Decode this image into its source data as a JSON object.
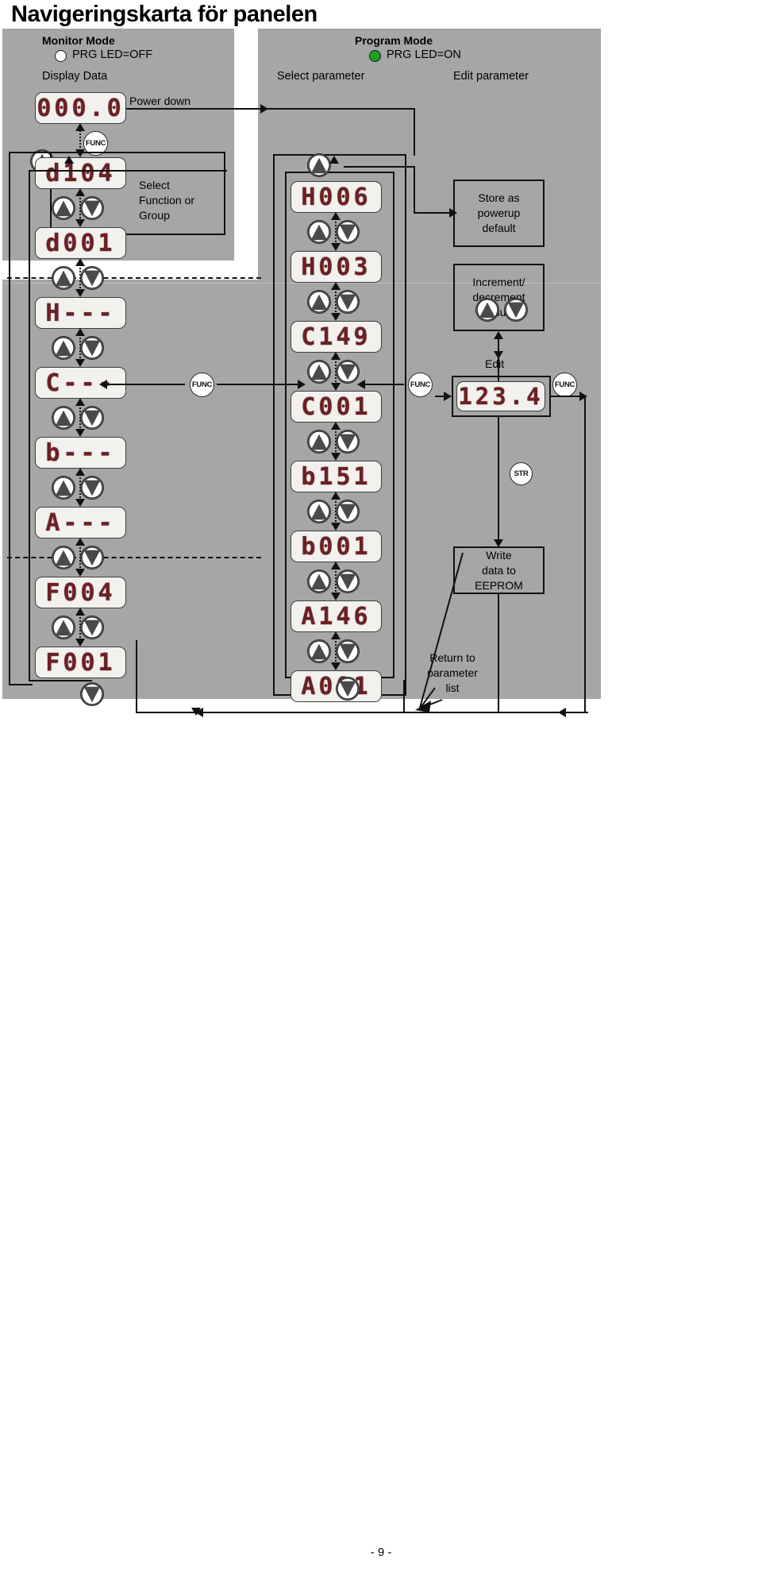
{
  "page": {
    "title": "Navigeringskarta för panelen",
    "footer": "- 9 -"
  },
  "monitor_mode": {
    "heading": "Monitor Mode",
    "led_label": "PRG LED=OFF",
    "led_state": "off",
    "led_color": "#ffffff",
    "column_label": "Display Data",
    "power_down_label": "Power down",
    "select_function_label": "Select\nFunction or\nGroup",
    "select_function_lines": [
      "Select",
      "Function or",
      "Group"
    ],
    "displays": [
      {
        "value": "000.0",
        "name": "display-000-0"
      },
      {
        "value": "d104",
        "name": "display-d104"
      },
      {
        "value": "d001",
        "name": "display-d001"
      },
      {
        "value": "H---",
        "name": "display-h-dashes"
      },
      {
        "value": "C---",
        "name": "display-c-dashes"
      },
      {
        "value": "b---",
        "name": "display-b-dashes"
      },
      {
        "value": "A---",
        "name": "display-a-dashes"
      },
      {
        "value": "F004",
        "name": "display-f004"
      },
      {
        "value": "F001",
        "name": "display-f001"
      }
    ]
  },
  "program_mode": {
    "heading": "Program Mode",
    "led_label": "PRG LED=ON",
    "led_state": "on",
    "led_color": "#1f9f21",
    "select_parameter_label": "Select parameter",
    "edit_parameter_label": "Edit parameter",
    "edit_label": "Edit",
    "displays": [
      {
        "value": "H006",
        "name": "display-h006"
      },
      {
        "value": "H003",
        "name": "display-h003"
      },
      {
        "value": "C149",
        "name": "display-c149"
      },
      {
        "value": "C001",
        "name": "display-c001"
      },
      {
        "value": "b151",
        "name": "display-b151"
      },
      {
        "value": "b001",
        "name": "display-b001"
      },
      {
        "value": "A146",
        "name": "display-a146"
      },
      {
        "value": "A001",
        "name": "display-a001"
      }
    ],
    "edit_display": {
      "value": "123.4",
      "name": "display-edit-value"
    }
  },
  "action_boxes": [
    {
      "name": "store-as-powerup-default-box",
      "lines": [
        "Store as",
        "powerup",
        "default"
      ]
    },
    {
      "name": "increment-decrement-value-box",
      "lines": [
        "Increment/",
        "decrement",
        "value"
      ]
    },
    {
      "name": "write-data-to-eeprom-box",
      "lines": [
        "Write",
        "data to",
        "EEPROM"
      ]
    }
  ],
  "return_label": {
    "lines": [
      "Return to",
      "parameter",
      "list"
    ]
  },
  "buttons": {
    "func": "FUNC",
    "str": "STR",
    "up": "1",
    "down": "2"
  },
  "colors": {
    "panel_bg": "#a6a6a6",
    "line": "#111111",
    "led_segment": "#6d2024",
    "display_bg": "#f2f1ee",
    "led_on": "#1f9f21"
  }
}
